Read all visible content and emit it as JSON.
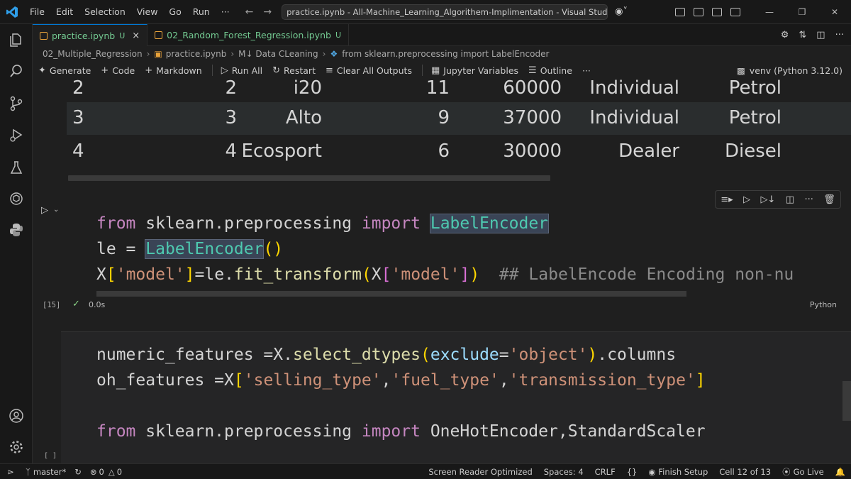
{
  "menu": [
    "File",
    "Edit",
    "Selection",
    "View",
    "Go",
    "Run",
    "···"
  ],
  "title_search": "practice.ipynb - All-Machine_Learning_Algorithem-Implimentation - Visual Studio Code - Untr",
  "tabs": [
    {
      "name": "practice.ipynb",
      "status": "U",
      "close": "×"
    },
    {
      "name": "02_Random_Forest_Regression.ipynb",
      "status": "U"
    }
  ],
  "breadcrumb": [
    "02_Multiple_Regression",
    "practice.ipynb",
    "M↓ Data CLeaning",
    "from sklearn.preprocessing import LabelEncoder"
  ],
  "toolbar": {
    "generate": "Generate",
    "code": "Code",
    "markdown": "Markdown",
    "run_all": "Run All",
    "restart": "Restart",
    "clear_outputs": "Clear All Outputs",
    "variables": "Jupyter Variables",
    "outline": "Outline",
    "more": "···",
    "kernel": "venv (Python 3.12.0)"
  },
  "dataframe": {
    "rows": [
      {
        "index": "2",
        "col_a": "2",
        "model": "i20",
        "num": "11",
        "price": "60000",
        "seller": "Individual",
        "fuel": "Petrol"
      },
      {
        "index": "3",
        "col_a": "3",
        "model": "Alto",
        "num": "9",
        "price": "37000",
        "seller": "Individual",
        "fuel": "Petrol"
      },
      {
        "index": "4",
        "col_a": "4",
        "model": "Ecosport",
        "num": "6",
        "price": "30000",
        "seller": "Dealer",
        "fuel": "Diesel"
      }
    ]
  },
  "cell1": {
    "exec_count": "[15]",
    "exec_time": "0.0s",
    "language": "Python",
    "line1": {
      "kw1": "from",
      "mod": " sklearn.preprocessing ",
      "kw2": "import",
      "sp": " ",
      "cls": "LabelEncoder"
    },
    "line2": {
      "var": "le ",
      "eq": "=",
      "sp": " ",
      "cls": "LabelEncoder",
      "paren": "()"
    },
    "line3": {
      "x": "X",
      "b1": "[",
      "s1": "'model'",
      "b2": "]",
      "eq": "=",
      "obj": "le.",
      "fn": "fit_transform",
      "p1": "(",
      "x2": "X",
      "b3": "[",
      "s2": "'model'",
      "b4": "]",
      "p2": ")",
      "comment": "  ## LabelEncode Encoding non-nu"
    }
  },
  "cell2": {
    "exec_count": "[ ]",
    "line1": {
      "var": "numeric_features ",
      "eq": "=",
      "obj": "X.",
      "fn": "select_dtypes",
      "p1": "(",
      "arg": "exclude",
      "eq2": "=",
      "s": "'object'",
      "p2": ")",
      "rest": ".columns"
    },
    "line2": {
      "var": "oh_features ",
      "eq": "=",
      "x": "X",
      "b1": "[",
      "s1": "'selling_type'",
      "c1": ",",
      "s2": "'fuel_type'",
      "c2": ",",
      "s3": "'transmission_type'",
      "b2": "]"
    },
    "line4": {
      "kw1": "from",
      "mod": " sklearn.preprocessing ",
      "kw2": "import",
      "rest": " OneHotEncoder,StandardScaler"
    }
  },
  "status": {
    "branch": "master*",
    "errors": "0",
    "warnings": "0",
    "screen_reader": "Screen Reader Optimized",
    "spaces": "Spaces: 4",
    "eol": "CRLF",
    "braces": "{}",
    "finish_setup": "Finish Setup",
    "cell": "Cell 12 of 13",
    "go_live": "Go Live"
  }
}
